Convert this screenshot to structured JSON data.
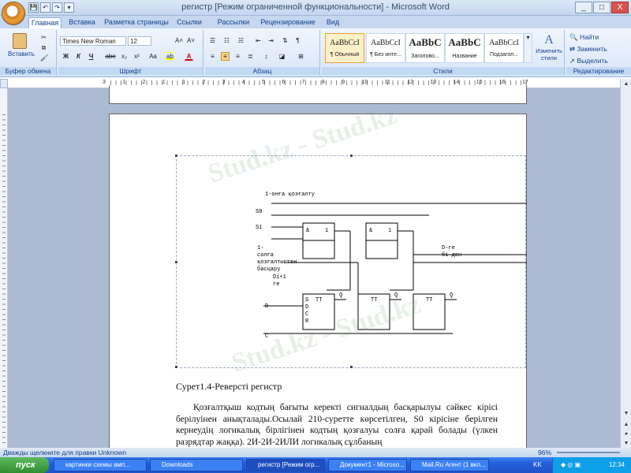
{
  "window": {
    "title": "регистр [Режим ограниченной функциональности] - Microsoft Word",
    "minimize": "_",
    "maximize": "□",
    "close": "X"
  },
  "office_button": "W",
  "qat": [
    "💾",
    "↶",
    "↷",
    "▾"
  ],
  "tabs": [
    "Главная",
    "Вставка",
    "Разметка страницы",
    "Ссылки",
    "Рассылки",
    "Рецензирование",
    "Вид"
  ],
  "ribbon": {
    "clipboard": {
      "label": "Буфер обмена",
      "paste": "Вставить"
    },
    "font": {
      "label": "Шрифт",
      "name": "Times New Roman",
      "size": "12",
      "bold": "Ж",
      "italic": "К",
      "underline": "Ч",
      "strike": "abe",
      "sub": "x₂",
      "sup": "x²",
      "case": "Aa",
      "grow": "A˄",
      "shrink": "A˅"
    },
    "paragraph": {
      "label": "Абзац",
      "pilcrow": "¶"
    },
    "styles": {
      "label": "Стили",
      "items": [
        {
          "sample": "AaBbCcI",
          "name": "¶ Обычный"
        },
        {
          "sample": "AaBbCcI",
          "name": "¶ Без инте..."
        },
        {
          "sample": "AaBbC",
          "name": "Заголово..."
        },
        {
          "sample": "AaBbC",
          "name": "Название"
        },
        {
          "sample": "AaBbCcI",
          "name": "Подзагол..."
        }
      ],
      "change": "Изменить стили"
    },
    "editing": {
      "label": "Редактирование",
      "find": "Найти",
      "replace": "Заменить",
      "select": "Выделить"
    }
  },
  "ruler_numbers": [
    "3",
    "1",
    "2",
    "1",
    "1",
    "2",
    "3",
    "4",
    "5",
    "6",
    "7",
    "8",
    "9",
    "10",
    "11",
    "12",
    "13",
    "14",
    "15",
    "16",
    "17"
  ],
  "diagram": {
    "top_label": "1-онға қозғалту",
    "s0": "S0",
    "s1": "S1",
    "left_label_lines": [
      "1-",
      "солға",
      "қозғалтыштен",
      "басқару"
    ],
    "di": "Di+1",
    "ge": "ге",
    "d_in": "D",
    "c_in": "C",
    "right_label": "D-ге",
    "right_label2": "бі ден",
    "and": "&",
    "or": "1",
    "tt": "TT",
    "s": "S",
    "d": "D",
    "c": "C",
    "r": "R",
    "q": "Q"
  },
  "document": {
    "caption": "Сурет1.4-Реверсті регистр",
    "paragraph": "Қозғалтқыш кодтың бағыты керекті сигналдың басқарылуы сәйкес кірісі берілуінен анықталады.Осылай 210-суретте көрсетілген, S0 кірісіне берілген кернеудің логикалық бірлігінен кодтың қозғалуы солға қарай болады (үлкен разрядтар жаққа). 2И-2И-2ИЛИ логикалық сұлбаның"
  },
  "watermark": "Stud.kz - Stud.kz",
  "status": {
    "left": "Дважды щелкните для правки Unknown",
    "zoom": "96%"
  },
  "taskbar": {
    "start": "пуск",
    "buttons": [
      "картинки схемы амп...",
      "Downloads",
      "регистр [Режим огр...",
      "Документ1 - Microso...",
      "Mail.Ru Агент (1 вкл..."
    ],
    "lang": "KK",
    "time": "12:34"
  }
}
